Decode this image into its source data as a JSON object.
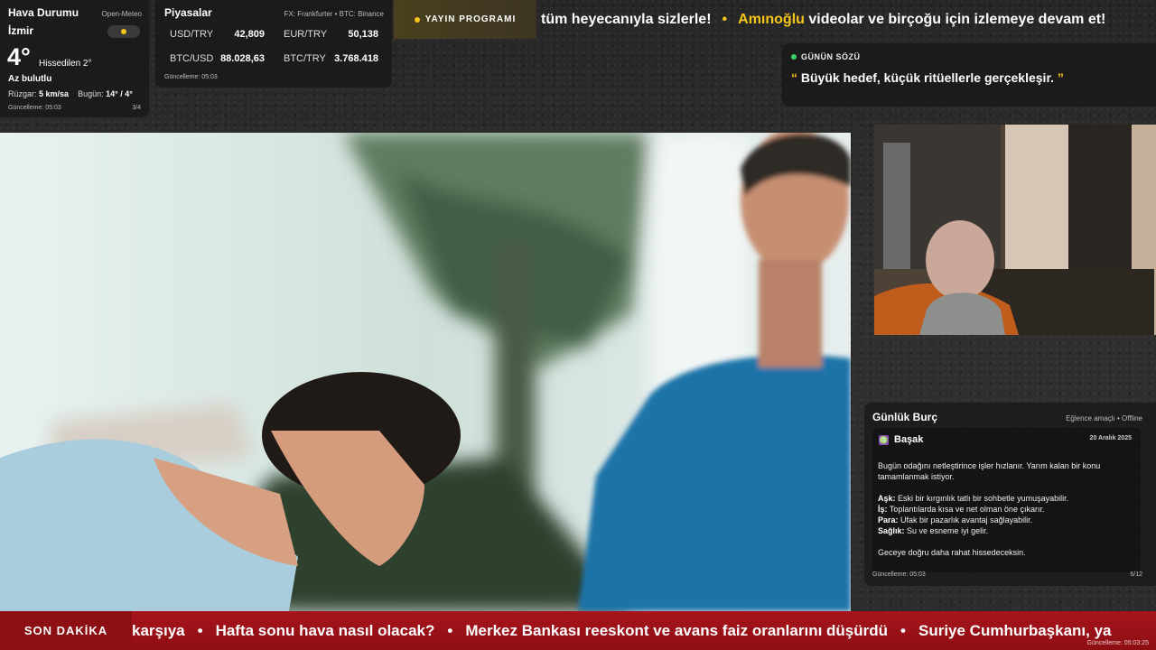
{
  "weather": {
    "title": "Hava Durumu",
    "source": "Open-Meteo",
    "city": "İzmir",
    "temp": "4°",
    "feels": "Hissedilen 2°",
    "condition": "Az bulutlu",
    "wind_label": "Rüzgar:",
    "wind_value": "5 km/sa",
    "today_label": "Bugün:",
    "today_value": "14° / 4°",
    "updated": "Güncelleme: 05:03",
    "page": "3/4",
    "icon": "sun-cloud-icon"
  },
  "markets": {
    "title": "Piyasalar",
    "source": "FX: Frankfurter • BTC: Binance",
    "rows": [
      {
        "key": "USD/TRY",
        "value": "42,809"
      },
      {
        "key": "EUR/TRY",
        "value": "50,138"
      },
      {
        "key": "BTC/USD",
        "value": "88.028,63"
      },
      {
        "key": "BTC/TRY",
        "value": "3.768.418"
      }
    ],
    "updated": "Güncelleme: 05:03"
  },
  "schedule": {
    "label": "YAYIN PROGRAMI"
  },
  "ticker": {
    "part1": "tüm heyecanıyla sizlerle!",
    "highlight": "Amınoğlu",
    "part2": "videolar ve birçoğu için izlemeye devam et!",
    "separator": "•"
  },
  "quote": {
    "label": "GÜNÜN SÖZÜ",
    "open": "“",
    "text": "Büyük hedef, küçük ritüellerle gerçekleşir.",
    "close": "”"
  },
  "horoscope": {
    "title": "Günlük Burç",
    "tag": "Eğlence amaçlı • Offline",
    "sign": "Başak",
    "sign_icon": "♍",
    "date": "20 Aralık 2025",
    "intro": "Bugün odağını netleştirince işler hızlanır. Yarım kalan bir konu tamamlanmak istiyor.",
    "love_label": "Aşk:",
    "love": "Eski bir kırgınlık tatlı bir sohbetle yumuşayabilir.",
    "work_label": "İş:",
    "work": "Toplantılarda kısa ve net olman öne çıkarır.",
    "money_label": "Para:",
    "money": "Ufak bir pazarlık avantaj sağlayabilir.",
    "health_label": "Sağlık:",
    "health": "Su ve esneme iyi gelir.",
    "outro": "Geceye doğru daha rahat hissedeceksin.",
    "updated": "Güncelleme: 05:03",
    "page": "6/12"
  },
  "breaking": {
    "label": "SON DAKİKA",
    "items": [
      "karşıya",
      "Hafta sonu hava nasıl olacak?",
      "Merkez Bankası reeskont ve avans faiz oranlarını düşürdü",
      "Suriye Cumhurbaşkanı, ya"
    ],
    "separator": "•",
    "updated": "Güncelleme: 05:03:25"
  },
  "colors": {
    "accent": "#f5c518",
    "breaking_red": "#a8141b",
    "panel": "#181818",
    "status_green": "#3cd060"
  }
}
